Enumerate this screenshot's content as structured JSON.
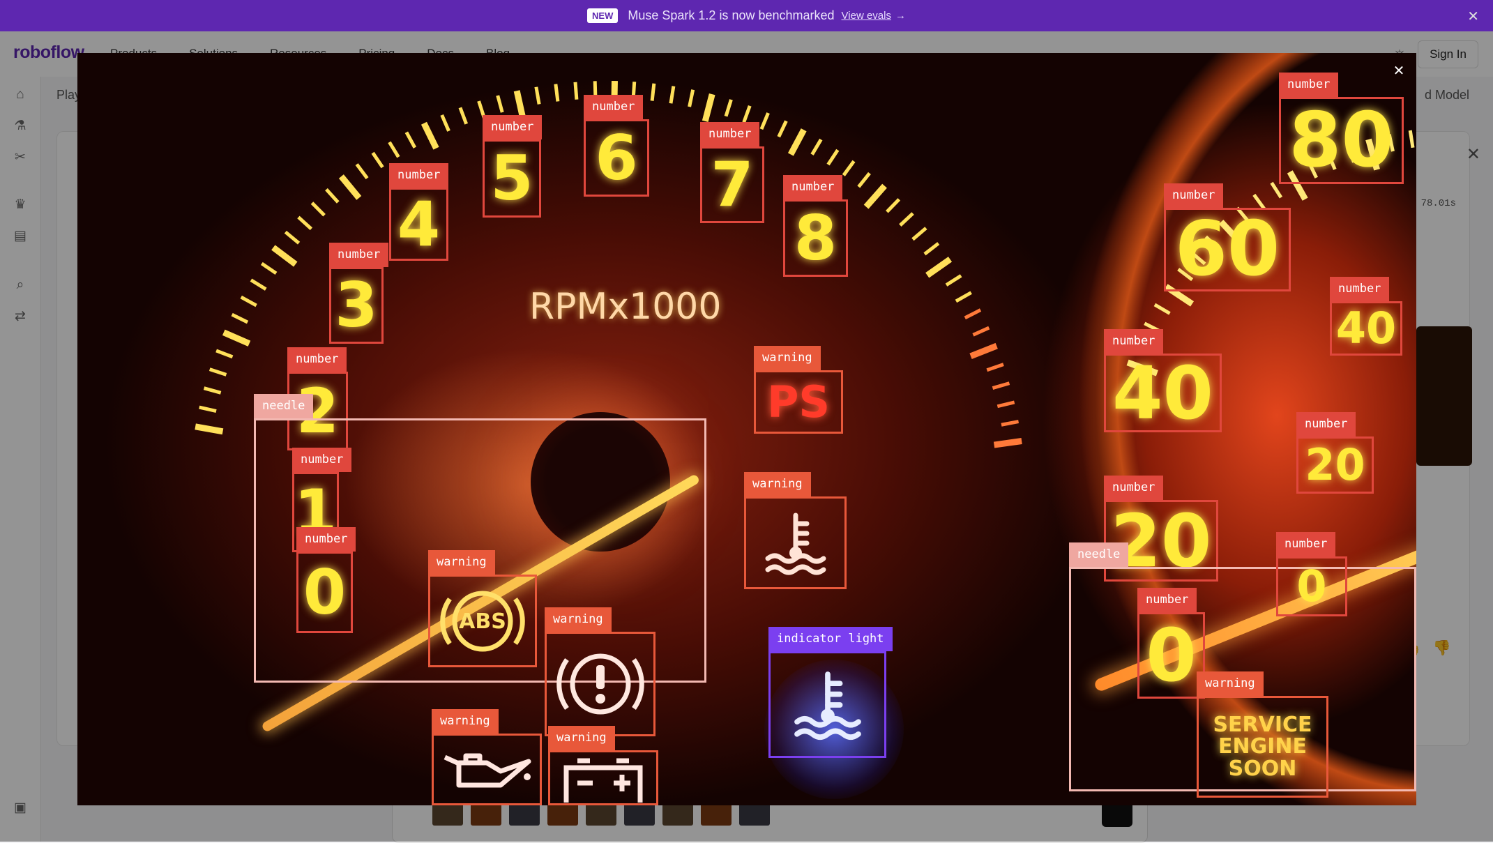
{
  "announcement": {
    "badge": "NEW",
    "message": "Muse Spark 1.2 is now benchmarked",
    "link": "View evals",
    "arrow": "→",
    "close": "✕"
  },
  "nav": {
    "logo": "roboflow",
    "menu": [
      "Products",
      "Solutions",
      "Resources",
      "Pricing",
      "Docs",
      "Blog"
    ],
    "sign_in": "Sign In"
  },
  "page": {
    "breadcrumb": "Play",
    "model_label": "d Model",
    "timing": "78.01s"
  },
  "modal": {
    "close": "✕",
    "rpm_text": "RPMx1000",
    "ps_text": "PS",
    "abs_text": "ABS",
    "service_text": "SERVICE ENGINE SOON",
    "detections": [
      {
        "label": "number",
        "text": "5"
      },
      {
        "label": "number",
        "text": "6"
      },
      {
        "label": "number",
        "text": "7"
      },
      {
        "label": "number",
        "text": "8"
      },
      {
        "label": "number",
        "text": "4"
      },
      {
        "label": "number",
        "text": "3"
      },
      {
        "label": "number",
        "text": "2"
      },
      {
        "label": "needle",
        "text": ""
      },
      {
        "label": "number",
        "text": "1"
      },
      {
        "label": "number",
        "text": "0"
      },
      {
        "label": "warning",
        "text": ""
      },
      {
        "label": "warning",
        "text": ""
      },
      {
        "label": "warning",
        "text": ""
      },
      {
        "label": "warning",
        "text": ""
      },
      {
        "label": "warning",
        "text": ""
      },
      {
        "label": "warning",
        "text": ""
      },
      {
        "label": "indicator light",
        "text": ""
      },
      {
        "label": "number",
        "text": "80"
      },
      {
        "label": "number",
        "text": "60"
      },
      {
        "label": "number",
        "text": "40"
      },
      {
        "label": "number",
        "text": "40"
      },
      {
        "label": "number",
        "text": "20"
      },
      {
        "label": "number",
        "text": "20"
      },
      {
        "label": "needle",
        "text": ""
      },
      {
        "label": "number",
        "text": "0"
      },
      {
        "label": "number",
        "text": "0"
      },
      {
        "label": "warning",
        "text": ""
      }
    ]
  },
  "colors": {
    "brand": "#5e27b0",
    "number_box": "#e0473d",
    "warning_box": "#e8583a",
    "needle_box": "#efa7a0",
    "indicator_box": "#7b3ff0"
  }
}
